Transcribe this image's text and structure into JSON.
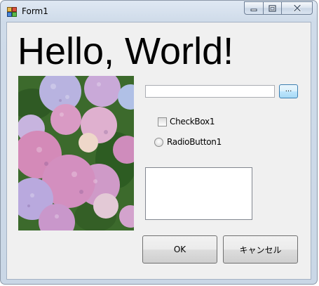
{
  "window": {
    "title": "Form1"
  },
  "content": {
    "heading": "Hello, World!",
    "picture_alt": "hydrangea photo",
    "textbox_value": "",
    "browse_label": "...",
    "checkbox_label": "CheckBox1",
    "checkbox_checked": false,
    "radio_label": "RadioButton1",
    "radio_selected": false,
    "ok_label": "OK",
    "cancel_label": "キャンセル"
  },
  "colors": {
    "accent_button_border": "#3c7fb1",
    "flower_pink": "#d99ac4",
    "flower_lilac": "#b6a6dc",
    "leaf_green": "#3c6a2c"
  },
  "icons": [
    "app-icon",
    "minimize-icon",
    "maximize-icon",
    "close-icon"
  ]
}
